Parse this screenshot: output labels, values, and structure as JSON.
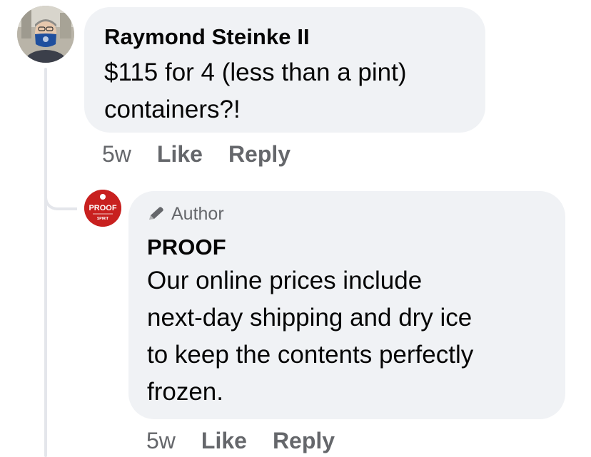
{
  "comments": [
    {
      "author": "Raymond Steinke II",
      "text_lines": [
        "$115 for 4 (less than a pint)",
        "containers?!"
      ],
      "time": "5w",
      "like_label": "Like",
      "reply_label": "Reply"
    }
  ],
  "reply": {
    "badge": "Author",
    "author": "PROOF",
    "avatar_text": "PROOF",
    "avatar_subtext": "SPIRIT",
    "text_lines": [
      "Our online prices include",
      "next-day shipping and dry ice",
      "to keep the contents perfectly",
      "frozen."
    ],
    "time": "5w",
    "like_label": "Like",
    "reply_label": "Reply"
  },
  "colors": {
    "bubble": "#f0f2f5",
    "meta": "#65676b",
    "text": "#050505",
    "proof_red": "#c8201f"
  }
}
